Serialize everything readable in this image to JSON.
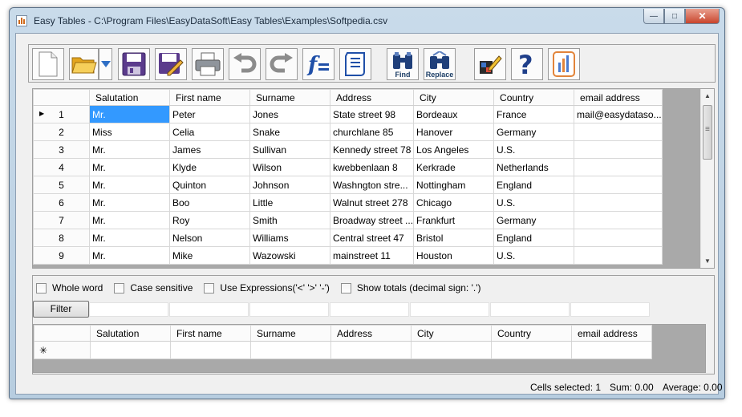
{
  "window": {
    "title": "Easy Tables - C:\\Program Files\\EasyDataSoft\\Easy Tables\\Examples\\Softpedia.csv",
    "controls": [
      "minimize",
      "maximize",
      "close"
    ]
  },
  "toolbar": {
    "buttons": [
      {
        "icon": "new-document-icon"
      },
      {
        "icon": "open-folder-icon"
      },
      {
        "icon": "dropdown-arrow-icon"
      },
      {
        "icon": "save-icon"
      },
      {
        "icon": "edit-save-icon"
      },
      {
        "icon": "print-icon"
      },
      {
        "icon": "undo-icon"
      },
      {
        "icon": "redo-icon"
      },
      {
        "icon": "formula-icon"
      },
      {
        "icon": "script-icon"
      },
      {
        "icon": "find-icon",
        "label": "Find"
      },
      {
        "icon": "replace-icon",
        "label": "Replace"
      },
      {
        "icon": "edit-icon"
      },
      {
        "icon": "help-icon"
      },
      {
        "icon": "chart-icon"
      }
    ]
  },
  "grid": {
    "columns": [
      "Salutation",
      "First name",
      "Surname",
      "Address",
      "City",
      "Country",
      "email address"
    ],
    "rows": [
      {
        "num": "1",
        "cells": [
          "Mr.",
          "Peter",
          "Jones",
          "State  street 98",
          "Bordeaux",
          "France",
          "mail@easydataso..."
        ]
      },
      {
        "num": "2",
        "cells": [
          "Miss",
          "Celia",
          "Snake",
          "churchlane 85",
          "Hanover",
          "Germany",
          ""
        ]
      },
      {
        "num": "3",
        "cells": [
          "Mr.",
          "James",
          "Sullivan",
          "Kennedy  street 78",
          "Los Angeles",
          "U.S.",
          ""
        ]
      },
      {
        "num": "4",
        "cells": [
          "Mr.",
          "Klyde",
          "Wilson",
          "kwebbenlaan 8",
          "Kerkrade",
          "Netherlands",
          ""
        ]
      },
      {
        "num": "5",
        "cells": [
          "Mr.",
          "Quinton",
          "Johnson",
          "Washngton  stre...",
          "Nottingham",
          "England",
          ""
        ]
      },
      {
        "num": "6",
        "cells": [
          "Mr.",
          "Boo",
          "Little",
          "Walnut  street 278",
          "Chicago",
          "U.S.",
          ""
        ]
      },
      {
        "num": "7",
        "cells": [
          "Mr.",
          "Roy",
          "Smith",
          "Broadway  street ...",
          "Frankfurt",
          "Germany",
          ""
        ]
      },
      {
        "num": "8",
        "cells": [
          "Mr.",
          "Nelson",
          "Williams",
          "Central  street 47",
          "Bristol",
          "England",
          ""
        ]
      },
      {
        "num": "9",
        "cells": [
          "Mr.",
          "Mike",
          "Wazowski",
          "mainstreet 11",
          "Houston",
          "U.S.",
          ""
        ]
      }
    ],
    "current_row_marker": "▶",
    "selected_cell": "Mr."
  },
  "filter": {
    "options": [
      {
        "label": "Whole word",
        "checked": false
      },
      {
        "label": "Case sensitive",
        "checked": false
      },
      {
        "label": "Use Expressions('<' '>' '-')",
        "checked": false
      },
      {
        "label": "Show totals (decimal sign: '.')",
        "checked": false
      }
    ],
    "button_label": "Filter",
    "new_row_marker": "✳"
  },
  "status": {
    "cells_selected": "Cells selected: 1",
    "sum": "Sum: 0.00",
    "average": "Average: 0.00"
  },
  "colors": {
    "selection": "#3399ff",
    "frame": "#b7cde0",
    "close_button": "#c9452d"
  }
}
